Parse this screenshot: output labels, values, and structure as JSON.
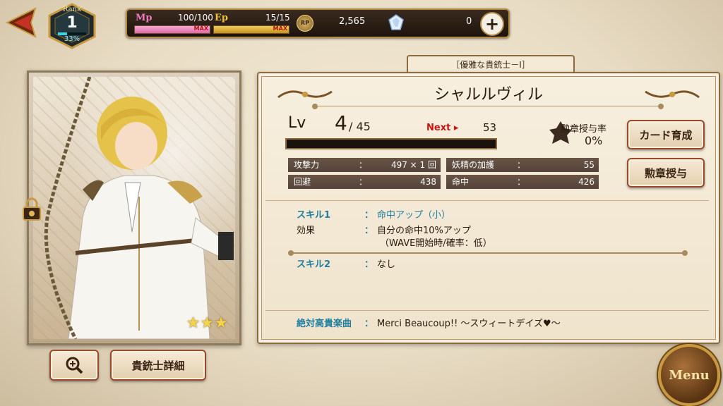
{
  "rank": {
    "label": "Rank",
    "value": "1",
    "progress": "33%"
  },
  "status": {
    "mp_label": "Mp",
    "mp_value": "100/100",
    "mp_max": "MAX",
    "ep_label": "Ep",
    "ep_value": "15/15",
    "ep_max": "MAX",
    "rp_icon": "RP",
    "rp_value": "2,565",
    "gem_value": "0"
  },
  "card": {
    "stars": 3
  },
  "buttons": {
    "detail": "貴銃士詳細",
    "menu": "Menu",
    "train": "カード育成",
    "medal": "勲章授与"
  },
  "info": {
    "title_tab": "［優雅な貴銃士－Ⅰ］",
    "name": "シャルルヴィル",
    "lv_label": "Lv",
    "lv_value": "4",
    "lv_max": "/ 45",
    "next_label": "Next ▸",
    "next_value": "53",
    "medal_rate_label": "勲章授与率",
    "medal_rate_value": "0%",
    "stats": [
      {
        "k": "攻撃力",
        "c": "：",
        "v": "497 × 1 回"
      },
      {
        "k": "妖精の加護",
        "c": "：",
        "v": "55"
      },
      {
        "k": "回避",
        "c": "：",
        "v": "438"
      },
      {
        "k": "命中",
        "c": "：",
        "v": "426"
      }
    ],
    "skill1_key": "スキル1",
    "skill1_value": "命中アップ（小）",
    "effect_key": "効果",
    "effect_line1": "自分の命中10%アップ",
    "effect_line2": "（WAVE開始時/確率：低）",
    "skill2_key": "スキル2",
    "skill2_value": "なし",
    "song_key": "絶対高貴楽曲",
    "song_value": "Merci Beaucoup!! ～スウィートデイズ♥～",
    "colon": "："
  },
  "colors": {
    "accent_blue": "#1e7fa0",
    "next_red": "#c81414",
    "mp_pink": "#e06aa8",
    "ep_gold": "#d4a12a"
  }
}
